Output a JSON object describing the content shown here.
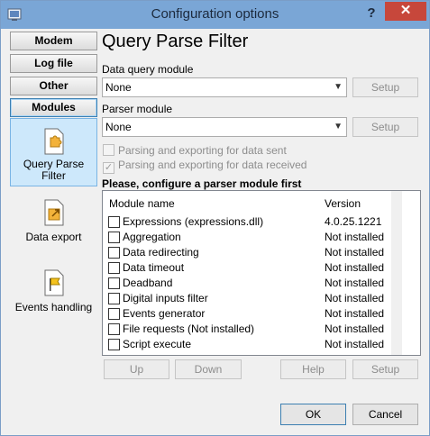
{
  "window": {
    "title": "Configuration options",
    "help_glyph": "?",
    "close_glyph": "✕"
  },
  "tabs": [
    {
      "label": "Modem",
      "active": false
    },
    {
      "label": "Log file",
      "active": false
    },
    {
      "label": "Other",
      "active": false
    },
    {
      "label": "Modules",
      "active": true
    }
  ],
  "sidebar": [
    {
      "label": "Query Parse Filter",
      "selected": true,
      "icon": "puzzle-icon"
    },
    {
      "label": "Data export",
      "selected": false,
      "icon": "export-icon"
    },
    {
      "label": "Events handling",
      "selected": false,
      "icon": "flag-icon"
    }
  ],
  "main": {
    "heading": "Query Parse Filter",
    "data_query_label": "Data query module",
    "data_query_value": "None",
    "parser_label": "Parser module",
    "parser_value": "None",
    "setup_label": "Setup",
    "check_sent": "Parsing and exporting for data sent",
    "check_sent_checked": false,
    "check_received": "Parsing and exporting for data received",
    "check_received_checked": true,
    "warning": "Please, configure a parser module first",
    "columns": {
      "name": "Module name",
      "version": "Version"
    },
    "modules": [
      {
        "name": "Expressions (expressions.dll)",
        "version": "4.0.25.1221"
      },
      {
        "name": "Aggregation",
        "version": "Not installed"
      },
      {
        "name": "Data redirecting",
        "version": "Not installed"
      },
      {
        "name": "Data timeout",
        "version": "Not installed"
      },
      {
        "name": "Deadband",
        "version": "Not installed"
      },
      {
        "name": "Digital inputs filter",
        "version": "Not installed"
      },
      {
        "name": "Events generator",
        "version": "Not installed"
      },
      {
        "name": "File requests (Not installed)",
        "version": "Not installed"
      },
      {
        "name": "Script execute",
        "version": "Not installed"
      }
    ],
    "up_label": "Up",
    "down_label": "Down",
    "help_label": "Help",
    "setup2_label": "Setup"
  },
  "footer": {
    "ok_label": "OK",
    "cancel_label": "Cancel"
  },
  "colors": {
    "titlebar": "#7aa6d6",
    "close": "#c7473b",
    "selection": "#cde8fb"
  }
}
